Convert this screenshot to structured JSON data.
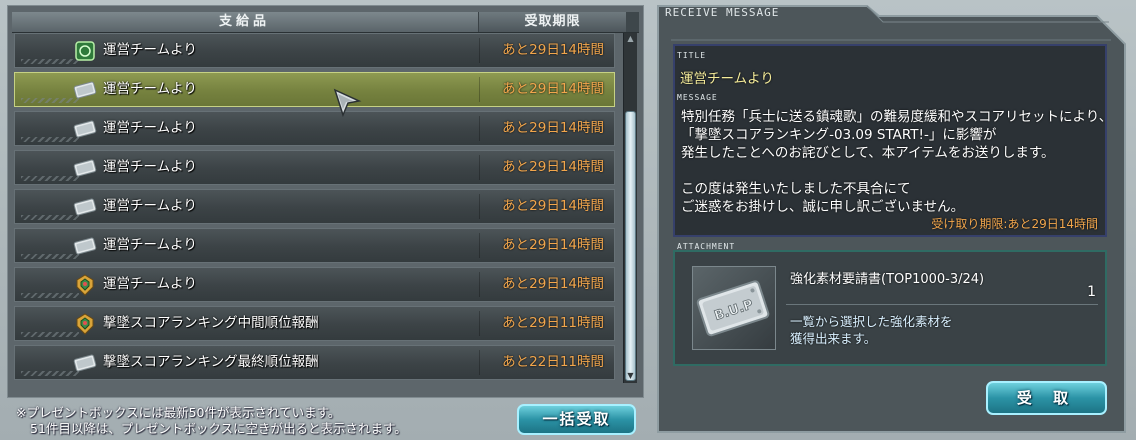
{
  "list": {
    "header_items": "支給品",
    "header_deadline": "受取期限",
    "rows": [
      {
        "icon": "green-medal-icon",
        "label": "運営チームより",
        "deadline": "あと29日14時間",
        "selected": false
      },
      {
        "icon": "ticket-icon",
        "label": "運営チームより",
        "deadline": "あと29日14時間",
        "selected": true
      },
      {
        "icon": "ticket-icon",
        "label": "運営チームより",
        "deadline": "あと29日14時間",
        "selected": false
      },
      {
        "icon": "ticket-icon",
        "label": "運営チームより",
        "deadline": "あと29日14時間",
        "selected": false
      },
      {
        "icon": "ticket-icon",
        "label": "運営チームより",
        "deadline": "あと29日14時間",
        "selected": false
      },
      {
        "icon": "ticket-icon",
        "label": "運営チームより",
        "deadline": "あと29日14時間",
        "selected": false
      },
      {
        "icon": "emblem-icon",
        "label": "運営チームより",
        "deadline": "あと29日14時間",
        "selected": false
      },
      {
        "icon": "emblem-icon",
        "label": "撃墜スコアランキング中間順位報酬",
        "deadline": "あと29日11時間",
        "selected": false
      },
      {
        "icon": "ticket-icon",
        "label": "撃墜スコアランキング最終順位報酬",
        "deadline": "あと22日11時間",
        "selected": false
      }
    ]
  },
  "notes": {
    "line1": "※プレゼントボックスには最新50件が表示されています。",
    "line2": "51件目以降は、プレゼントボックスに空きが出ると表示されます。"
  },
  "bulk_receive_label": "一括受取",
  "message_panel": {
    "heading": "RECEIVE MESSAGE",
    "title_label": "TITLE",
    "title": "運営チームより",
    "message_label": "MESSAGE",
    "message": "特別任務「兵士に送る鎮魂歌」の難易度緩和やスコアリセットにより、\n「撃墜スコアランキング-03.09 START!-」に影響が\n発生したことへのお詫びとして、本アイテムをお送りします。\n\nこの度は発生いたしました不具合にて\nご迷惑をお掛けし、誠に申し訳ございません。",
    "deadline": "受け取り期限:あと29日14時間",
    "attachment_label": "ATTACHMENT",
    "item_name": "強化素材要請書(TOP1000-3/24)",
    "item_qty": "1",
    "item_desc": "一覧から選択した強化素材を\n獲得出来ます。",
    "item_plate_text": "B.U.P"
  },
  "receive_label": "受 取",
  "colors": {
    "accent": "#2b93a6",
    "deadline": "#f2a64c",
    "selected_row": "#76823f",
    "sender": "#f5ec9a"
  }
}
